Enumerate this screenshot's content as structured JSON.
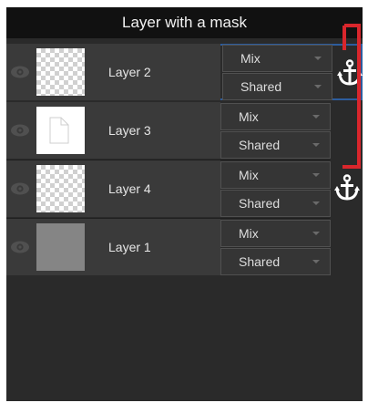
{
  "title": "Layer with a mask",
  "layers": [
    {
      "name": "Layer 2",
      "blend": "Mix",
      "mode": "Shared",
      "thumbnail": "checker",
      "selected": true,
      "anchored": true
    },
    {
      "name": "Layer 3",
      "blend": "Mix",
      "mode": "Shared",
      "thumbnail": "mask",
      "selected": false,
      "anchored": false
    },
    {
      "name": "Layer 4",
      "blend": "Mix",
      "mode": "Shared",
      "thumbnail": "checker",
      "selected": false,
      "anchored": true
    },
    {
      "name": "Layer 1",
      "blend": "Mix",
      "mode": "Shared",
      "thumbnail": "gray",
      "selected": false,
      "anchored": false
    }
  ],
  "icons": {
    "visibility": "eye-icon",
    "anchor": "anchor-icon",
    "dropdown": "chevron-down-icon"
  },
  "colors": {
    "selection_border": "#2d5d9e",
    "annotation_bracket": "#d9262c"
  }
}
